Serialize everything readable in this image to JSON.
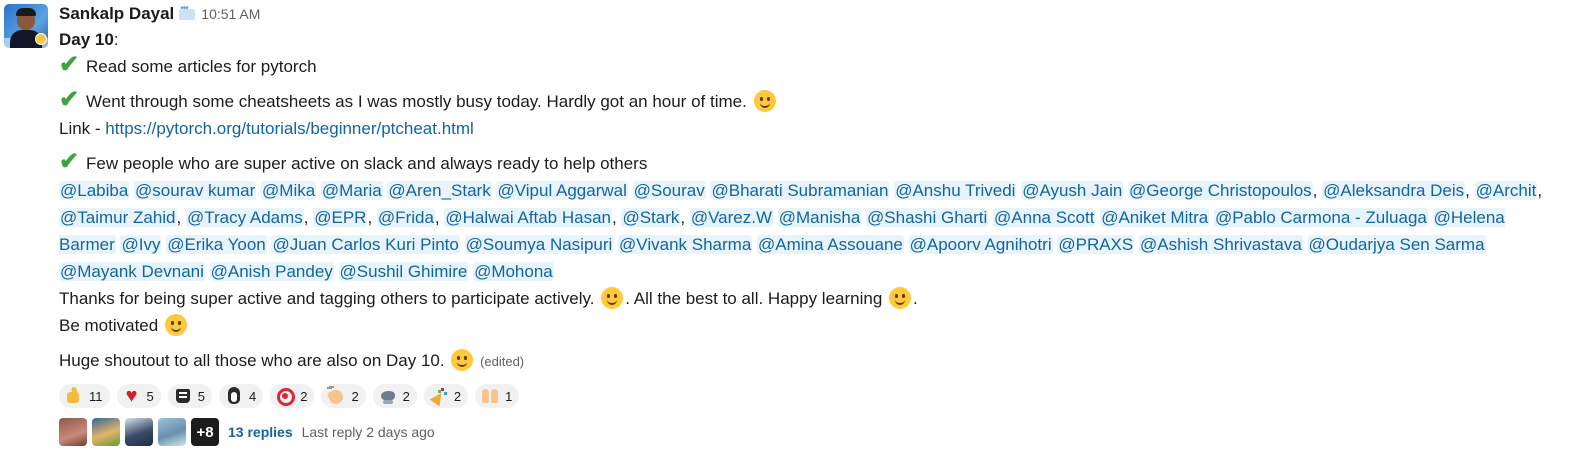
{
  "message": {
    "sender": "Sankalp Dayal",
    "time": "10:51 AM",
    "day_bold": "Day 10",
    "day_colon": ":",
    "line1": "Read some articles for pytorch",
    "line2": "Went through some cheatsheets as I was mostly busy today. Hardly got an hour of time.",
    "link_prefix": "Link - ",
    "link_url": "https://pytorch.org/tutorials/beginner/ptcheat.html",
    "line3": "Few people who are super active on slack and always ready to help others",
    "mentions": [
      {
        "name": "@Labiba",
        "sep": " "
      },
      {
        "name": "@sourav kumar",
        "sep": " "
      },
      {
        "name": "@Mika",
        "sep": "  "
      },
      {
        "name": "@Maria",
        "sep": "  "
      },
      {
        "name": "@Aren_Stark",
        "sep": "  "
      },
      {
        "name": "@Vipul Aggarwal",
        "sep": "  "
      },
      {
        "name": "@Sourav",
        "sep": "  "
      },
      {
        "name": "@Bharati Subramanian",
        "sep": "  "
      },
      {
        "name": "@Anshu Trivedi",
        "sep": "  "
      },
      {
        "name": "@Ayush Jain",
        "sep": " "
      },
      {
        "name": "@George Christopoulos",
        "sep": ", "
      },
      {
        "name": "@Aleksandra Deis",
        "sep": ", "
      },
      {
        "name": "@Archit",
        "sep": ", "
      },
      {
        "name": "@Taimur Zahid",
        "sep": ", "
      },
      {
        "name": "@Tracy Adams",
        "sep": ", "
      },
      {
        "name": "@EPR",
        "sep": ", "
      },
      {
        "name": "@Frida",
        "sep": ", "
      },
      {
        "name": "@Halwai Aftab Hasan",
        "sep": ", "
      },
      {
        "name": "@Stark",
        "sep": ", "
      },
      {
        "name": "@Varez.W",
        "sep": " "
      },
      {
        "name": "@Manisha",
        "sep": " "
      },
      {
        "name": "@Shashi Gharti",
        "sep": " "
      },
      {
        "name": "@Anna Scott",
        "sep": " "
      },
      {
        "name": "@Aniket Mitra",
        "sep": " "
      },
      {
        "name": "@Pablo Carmona - Zuluaga",
        "sep": " "
      },
      {
        "name": "@Helena Barmer",
        "sep": " "
      },
      {
        "name": "@Ivy",
        "sep": " "
      },
      {
        "name": "@Erika Yoon",
        "sep": " "
      },
      {
        "name": "@Juan Carlos Kuri Pinto",
        "sep": " "
      },
      {
        "name": "@Soumya Nasipuri",
        "sep": " "
      },
      {
        "name": "@Vivank Sharma",
        "sep": " "
      },
      {
        "name": "@Amina Assouane",
        "sep": " "
      },
      {
        "name": "@Apoorv Agnihotri",
        "sep": " "
      },
      {
        "name": "@PRAXS",
        "sep": " "
      },
      {
        "name": "@Ashish Shrivastava",
        "sep": " "
      },
      {
        "name": "@Oudarjya Sen Sarma",
        "sep": " "
      },
      {
        "name": "@Mayank Devnani",
        "sep": " "
      },
      {
        "name": "@Anish Pandey",
        "sep": " "
      },
      {
        "name": "@Sushil Ghimire",
        "sep": " "
      },
      {
        "name": "@Mohona",
        "sep": ""
      }
    ],
    "thanks_a": "Thanks for being super active and tagging others to participate actively.",
    "thanks_b": ". All the best to all. Happy learning",
    "thanks_c": ".",
    "motivated": "Be motivated",
    "shoutout": "Huge shoutout to all those who are also on Day 10.",
    "edited": "(edited)"
  },
  "reactions": [
    {
      "icon": "thumbs-up-icon",
      "count": "11"
    },
    {
      "icon": "heart-icon",
      "count": "5"
    },
    {
      "icon": "custom-emoji-icon",
      "count": "5"
    },
    {
      "icon": "penguin-icon",
      "count": "4"
    },
    {
      "icon": "target-icon",
      "count": "2"
    },
    {
      "icon": "clapping-hands-icon",
      "count": "2"
    },
    {
      "icon": "bird-icon",
      "count": "2"
    },
    {
      "icon": "party-popper-icon",
      "count": "2"
    },
    {
      "icon": "raised-hands-icon",
      "count": "1"
    }
  ],
  "thread": {
    "more_count": "+8",
    "replies": "13 replies",
    "last_reply": "Last reply 2 days ago"
  },
  "colors": {
    "link": "#1264a3",
    "mention_bg": "#e8f4fb",
    "check": "#3fa23a",
    "muted": "#616061"
  }
}
